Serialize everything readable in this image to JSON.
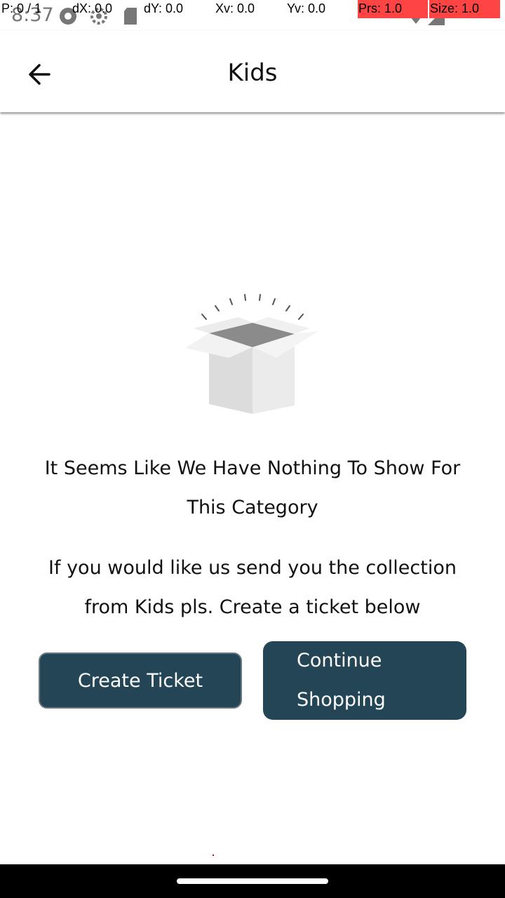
{
  "status_bar": {
    "time": "8:37",
    "icons": [
      "sync-icon",
      "settings-icon",
      "sd-card-icon",
      "wifi-icon",
      "signal-icon"
    ]
  },
  "pointer_overlay": {
    "p": "P: 0 / 1",
    "dx": "dX: 0.0",
    "dy": "dY: 0.0",
    "xv": "Xv: 0.0",
    "yv": "Yv: 0.0",
    "prs": "Prs: 1.0",
    "size": "Size: 1.0",
    "highlight_color": "#ff4444"
  },
  "app_bar": {
    "title": "Kids",
    "back_icon": "arrow-left-icon"
  },
  "empty_state": {
    "illustration": "open-box-icon",
    "headline": "It Seems Like We Have Nothing To Show For This Category",
    "message": "If you would like us send you the collection from Kids pls. Create a ticket below"
  },
  "actions": {
    "create_ticket": "Create Ticket",
    "continue_shopping": "Continue Shopping"
  },
  "colors": {
    "button_bg": "#234556",
    "button_text": "#ffffff",
    "background": "#ffffff"
  }
}
